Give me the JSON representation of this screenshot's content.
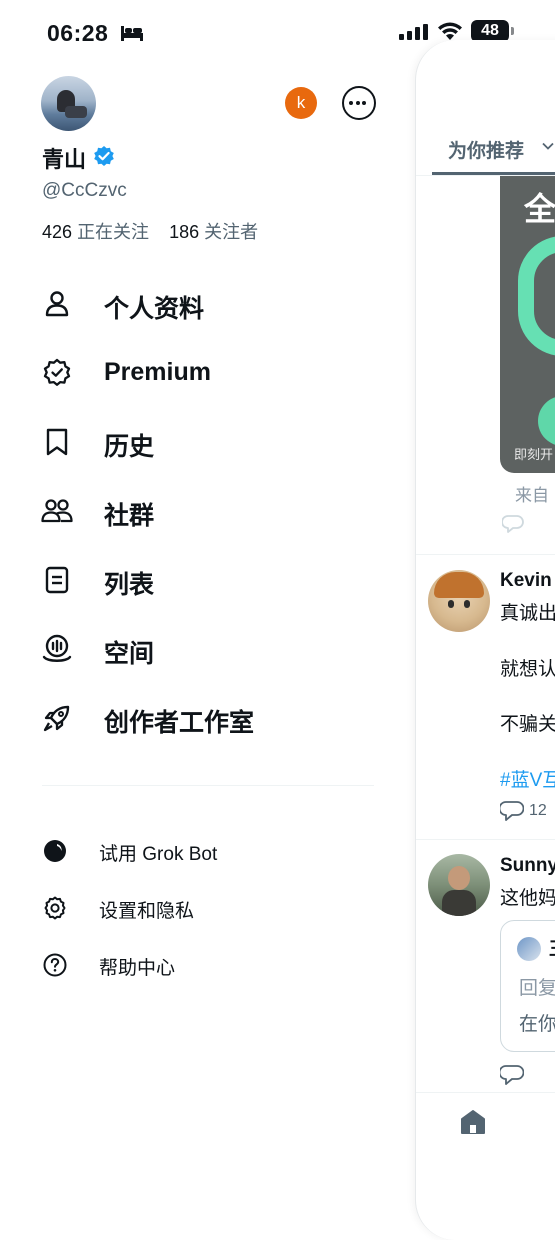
{
  "status_bar": {
    "time": "06:28",
    "battery": "48"
  },
  "profile": {
    "name": "青山",
    "handle": "@CcCzvc",
    "following_count": "426",
    "following_label": "正在关注",
    "followers_count": "186",
    "followers_label": "关注者",
    "other_account_initial": "k"
  },
  "menu": [
    {
      "label": "个人资料",
      "icon": "person-icon"
    },
    {
      "label": "Premium",
      "icon": "premium-badge-icon"
    },
    {
      "label": "历史",
      "icon": "bookmark-icon"
    },
    {
      "label": "社群",
      "icon": "communities-icon"
    },
    {
      "label": "列表",
      "icon": "list-icon"
    },
    {
      "label": "空间",
      "icon": "spaces-icon"
    },
    {
      "label": "创作者工作室",
      "icon": "rocket-icon"
    }
  ],
  "secondary_menu": [
    {
      "label": "试用 Grok Bot",
      "icon": "grok-icon"
    },
    {
      "label": "设置和隐私",
      "icon": "gear-icon"
    },
    {
      "label": "帮助中心",
      "icon": "help-icon"
    }
  ],
  "timeline": {
    "tab": "为你推荐",
    "ad": {
      "headline": "全",
      "caption": "即刻开",
      "from": "来自"
    },
    "posts": [
      {
        "author": "Kevin",
        "lines": [
          "真诚出",
          "就想认",
          "不骗关"
        ],
        "hashtag": "#蓝V互",
        "reply_count": "12"
      },
      {
        "author": "Sunny",
        "lines": [
          "这他妈"
        ],
        "quote": {
          "author": "王",
          "reply_prefix": "回复",
          "body": "在你"
        }
      }
    ]
  }
}
